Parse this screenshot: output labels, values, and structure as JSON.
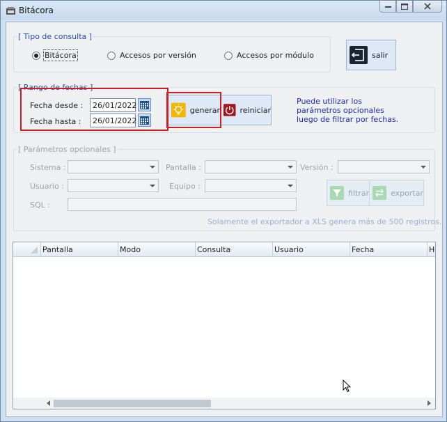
{
  "window": {
    "title": "Bitácora"
  },
  "tipo_consulta": {
    "legend": "[ Tipo de consulta ]",
    "options": [
      {
        "label": "Bitácora",
        "selected": true
      },
      {
        "label": "Accesos por versión",
        "selected": false
      },
      {
        "label": "Accesos por módulo",
        "selected": false
      }
    ],
    "salir_label": "salir"
  },
  "rango_fechas": {
    "legend": "[ Rango de fechas ]",
    "desde_label": "Fecha desde :",
    "desde_value": "26/01/2022",
    "hasta_label": "Fecha hasta :",
    "hasta_value": "26/01/2022",
    "generar_label": "generar",
    "reiniciar_label": "reiniciar",
    "note": "Puede utilizar los parámetros opcionales luego de filtrar por fechas."
  },
  "parametros": {
    "legend": "[ Parámetros opcionales ]",
    "sistema_label": "Sistema :",
    "pantalla_label": "Pantalla :",
    "version_label": "Versión :",
    "usuario_label": "Usuario :",
    "equipo_label": "Equipo :",
    "sql_label": "SQL :",
    "filtrar_label": "filtrar",
    "exportar_label": "exportar",
    "export_note": "Solamente el exportador a XLS genera más de 500 registros."
  },
  "grid": {
    "columns": [
      "Pantalla",
      "Modo",
      "Consulta",
      "Usuario",
      "Fecha",
      "Ho"
    ]
  },
  "colors": {
    "highlight": "#c81e24",
    "legend": "#1f4fb8",
    "note": "#1e2ab4"
  }
}
